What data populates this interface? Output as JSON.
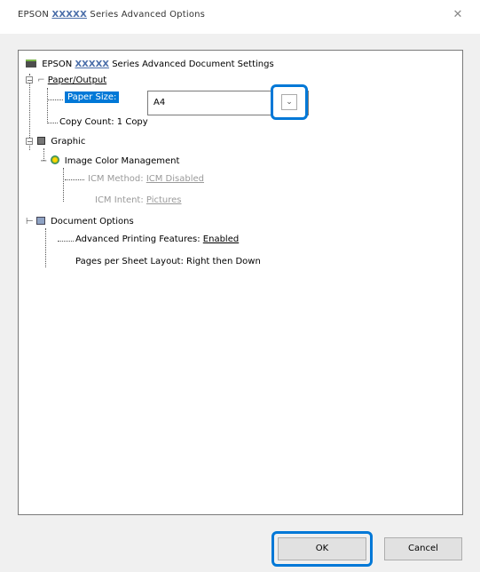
{
  "window": {
    "title_prefix": "EPSON",
    "title_brand": "XXXXX",
    "title_suffix": "Series Advanced Options",
    "close_glyph": "✕"
  },
  "tree": {
    "root": {
      "prefix": "EPSON",
      "brand": "XXXXX",
      "suffix": "Series Advanced Document Settings"
    },
    "paper_output": {
      "label": "Paper/Output"
    },
    "paper_size": {
      "label": "Paper Size:",
      "value": "A4",
      "chevron": "⌄"
    },
    "copy_count": {
      "label": "Copy Count: 1 Copy"
    },
    "graphic": {
      "label": "Graphic"
    },
    "icm": {
      "label": "Image Color Management"
    },
    "icm_method": {
      "label": "ICM Method:",
      "value": "ICM Disabled"
    },
    "icm_intent": {
      "label": "ICM Intent:",
      "value": "Pictures"
    },
    "document_options": {
      "label": "Document Options"
    },
    "advanced_printing": {
      "label": "Advanced Printing Features:",
      "value": "Enabled"
    },
    "pages_per_sheet": {
      "label": "Pages per Sheet Layout: Right then Down"
    }
  },
  "buttons": {
    "ok": "OK",
    "cancel": "Cancel"
  }
}
